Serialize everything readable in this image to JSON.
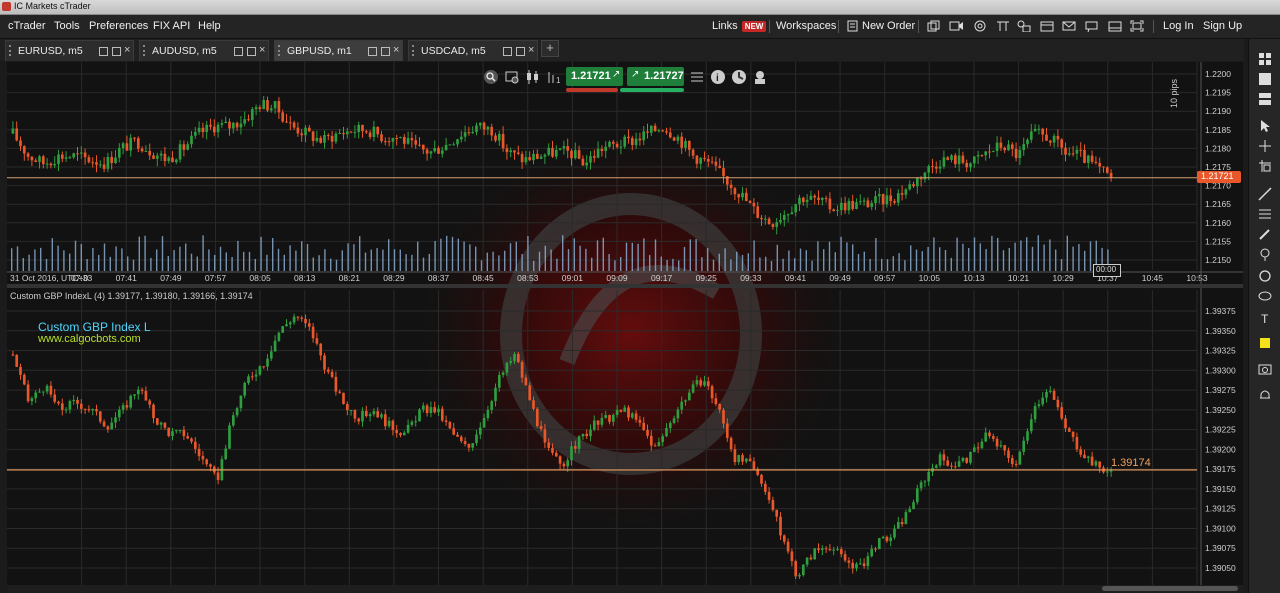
{
  "window": {
    "title": "IC Markets cTrader"
  },
  "menu": {
    "items": [
      "cTrader",
      "Tools",
      "Preferences",
      "FIX API",
      "Help"
    ]
  },
  "toolbar": {
    "links_label": "Links",
    "links_badge": "NEW",
    "workspaces_label": "Workspaces",
    "new_order_label": "New Order",
    "login_label": "Log In",
    "signup_label": "Sign Up"
  },
  "tabs": [
    {
      "label": "EURUSD, m5",
      "active": false
    },
    {
      "label": "AUDUSD, m5",
      "active": false
    },
    {
      "label": "GBPUSD, m1",
      "active": true
    },
    {
      "label": "USDCAD, m5",
      "active": false
    }
  ],
  "add_tab_label": "+",
  "price_panel": {
    "sell_price": "1.21721",
    "buy_price": "1.21727",
    "pip_scale_label": "10 pips",
    "current_price_label": "1.21721",
    "sell_color": "#1e7e3a",
    "buy_color": "#1e7e3a",
    "bar_colors": [
      "#c0392b",
      "#27ae60"
    ]
  },
  "main_chart": {
    "symbol": "GBPUSD",
    "timeframe": "m1",
    "current_price": 1.21721,
    "y_ticks": [
      "1.2200",
      "1.2195",
      "1.2190",
      "1.2185",
      "1.2180",
      "1.2175",
      "1.2170",
      "1.2165",
      "1.2160",
      "1.2155",
      "1.2150"
    ],
    "x_ticks": [
      "31 Oct 2016, UTC+0",
      "07:33",
      "07:41",
      "07:49",
      "07:57",
      "08:05",
      "08:13",
      "08:21",
      "08:29",
      "08:37",
      "08:45",
      "08:53",
      "09:01",
      "09:09",
      "09:17",
      "09:25",
      "09:33",
      "09:41",
      "09:49",
      "09:57",
      "10:05",
      "10:13",
      "10:21",
      "10:29",
      "10:37",
      "10:45",
      "10:53"
    ],
    "time_marker": "00:00",
    "close_path": [
      1.2184,
      1.2178,
      1.2176,
      1.2178,
      1.2178,
      1.2177,
      1.2176,
      1.218,
      1.2182,
      1.2179,
      1.2177,
      1.218,
      1.2184,
      1.2186,
      1.2186,
      1.2188,
      1.2192,
      1.2191,
      1.2186,
      1.2184,
      1.2182,
      1.2184,
      1.2185,
      1.2185,
      1.2183,
      1.2183,
      1.218,
      1.2179,
      1.2181,
      1.2184,
      1.2186,
      1.2185,
      1.2179,
      1.2177,
      1.2178,
      1.2179,
      1.2179,
      1.2176,
      1.218,
      1.2181,
      1.2182,
      1.2184,
      1.2186,
      1.2183,
      1.2178,
      1.2176,
      1.2172,
      1.2168,
      1.2163,
      1.216,
      1.2163,
      1.2167,
      1.2166,
      1.2164,
      1.2165,
      1.2165,
      1.2166,
      1.2167,
      1.217,
      1.2174,
      1.2177,
      1.2177,
      1.2176,
      1.2179,
      1.2181,
      1.2178,
      1.2184,
      1.2183,
      1.2179,
      1.2178,
      1.2175,
      1.2172
    ],
    "volume_bars": 190
  },
  "indicator": {
    "header": "Custom GBP IndexL (4) 1.39177, 1.39180, 1.39166, 1.39174",
    "title": "Custom GBP Index L",
    "site": "www.calgocbots.com",
    "current_value": 1.39174,
    "current_label": "1.39174",
    "y_ticks": [
      "1.39375",
      "1.39350",
      "1.39325",
      "1.39300",
      "1.39275",
      "1.39250",
      "1.39225",
      "1.39200",
      "1.39175",
      "1.39150",
      "1.39125",
      "1.39100",
      "1.39075",
      "1.39050"
    ],
    "close_path": [
      1.3932,
      1.3926,
      1.3928,
      1.3925,
      1.3926,
      1.3925,
      1.3923,
      1.3925,
      1.3928,
      1.3924,
      1.3922,
      1.3922,
      1.3919,
      1.3916,
      1.3924,
      1.3929,
      1.3931,
      1.3935,
      1.3937,
      1.3935,
      1.393,
      1.3926,
      1.3924,
      1.3925,
      1.3923,
      1.3922,
      1.3925,
      1.3925,
      1.3922,
      1.392,
      1.3924,
      1.3929,
      1.3932,
      1.3926,
      1.392,
      1.3918,
      1.3921,
      1.3923,
      1.3924,
      1.3925,
      1.3923,
      1.392,
      1.3924,
      1.3927,
      1.3929,
      1.3925,
      1.3919,
      1.3918,
      1.3915,
      1.3909,
      1.3904,
      1.3907,
      1.3908,
      1.3906,
      1.3905,
      1.3908,
      1.3909,
      1.3912,
      1.3916,
      1.3919,
      1.3918,
      1.3919,
      1.3922,
      1.392,
      1.3918,
      1.3925,
      1.3928,
      1.3923,
      1.392,
      1.3918,
      1.3917
    ]
  },
  "colors": {
    "bull": "#2e9e3e",
    "bear": "#e8582a",
    "background": "#121212",
    "grid": "#2a2a2a",
    "title_text": "#4fd6ff",
    "level_line": "#f0a060",
    "price_line": "#d4a070"
  }
}
